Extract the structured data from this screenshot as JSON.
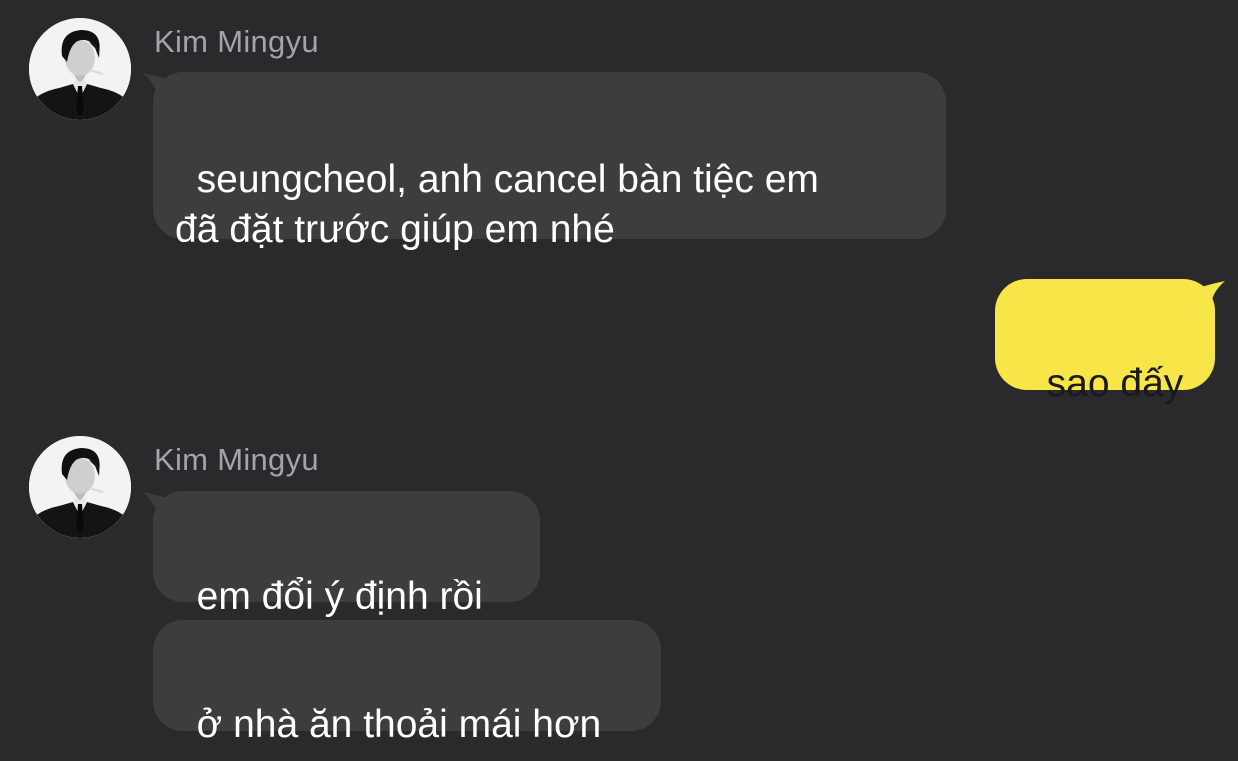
{
  "chat": {
    "colors": {
      "background": "#2a2a2c",
      "incoming_bubble": "#3d3d40",
      "outgoing_bubble": "#f8e548",
      "sender_name": "#a3a3a8"
    },
    "groups": [
      {
        "sender": "Kim Mingyu",
        "avatar_icon": "profile-photo-avatar",
        "messages": [
          "seungcheol, anh cancel bàn tiệc em\nđã đặt trước giúp em nhé"
        ]
      },
      {
        "sender": "Kim Mingyu",
        "avatar_icon": "profile-photo-avatar",
        "messages": [
          "em đổi ý định rồi",
          "ở nhà ăn thoải mái hơn"
        ]
      }
    ],
    "outgoing": [
      "sao đấy"
    ]
  }
}
